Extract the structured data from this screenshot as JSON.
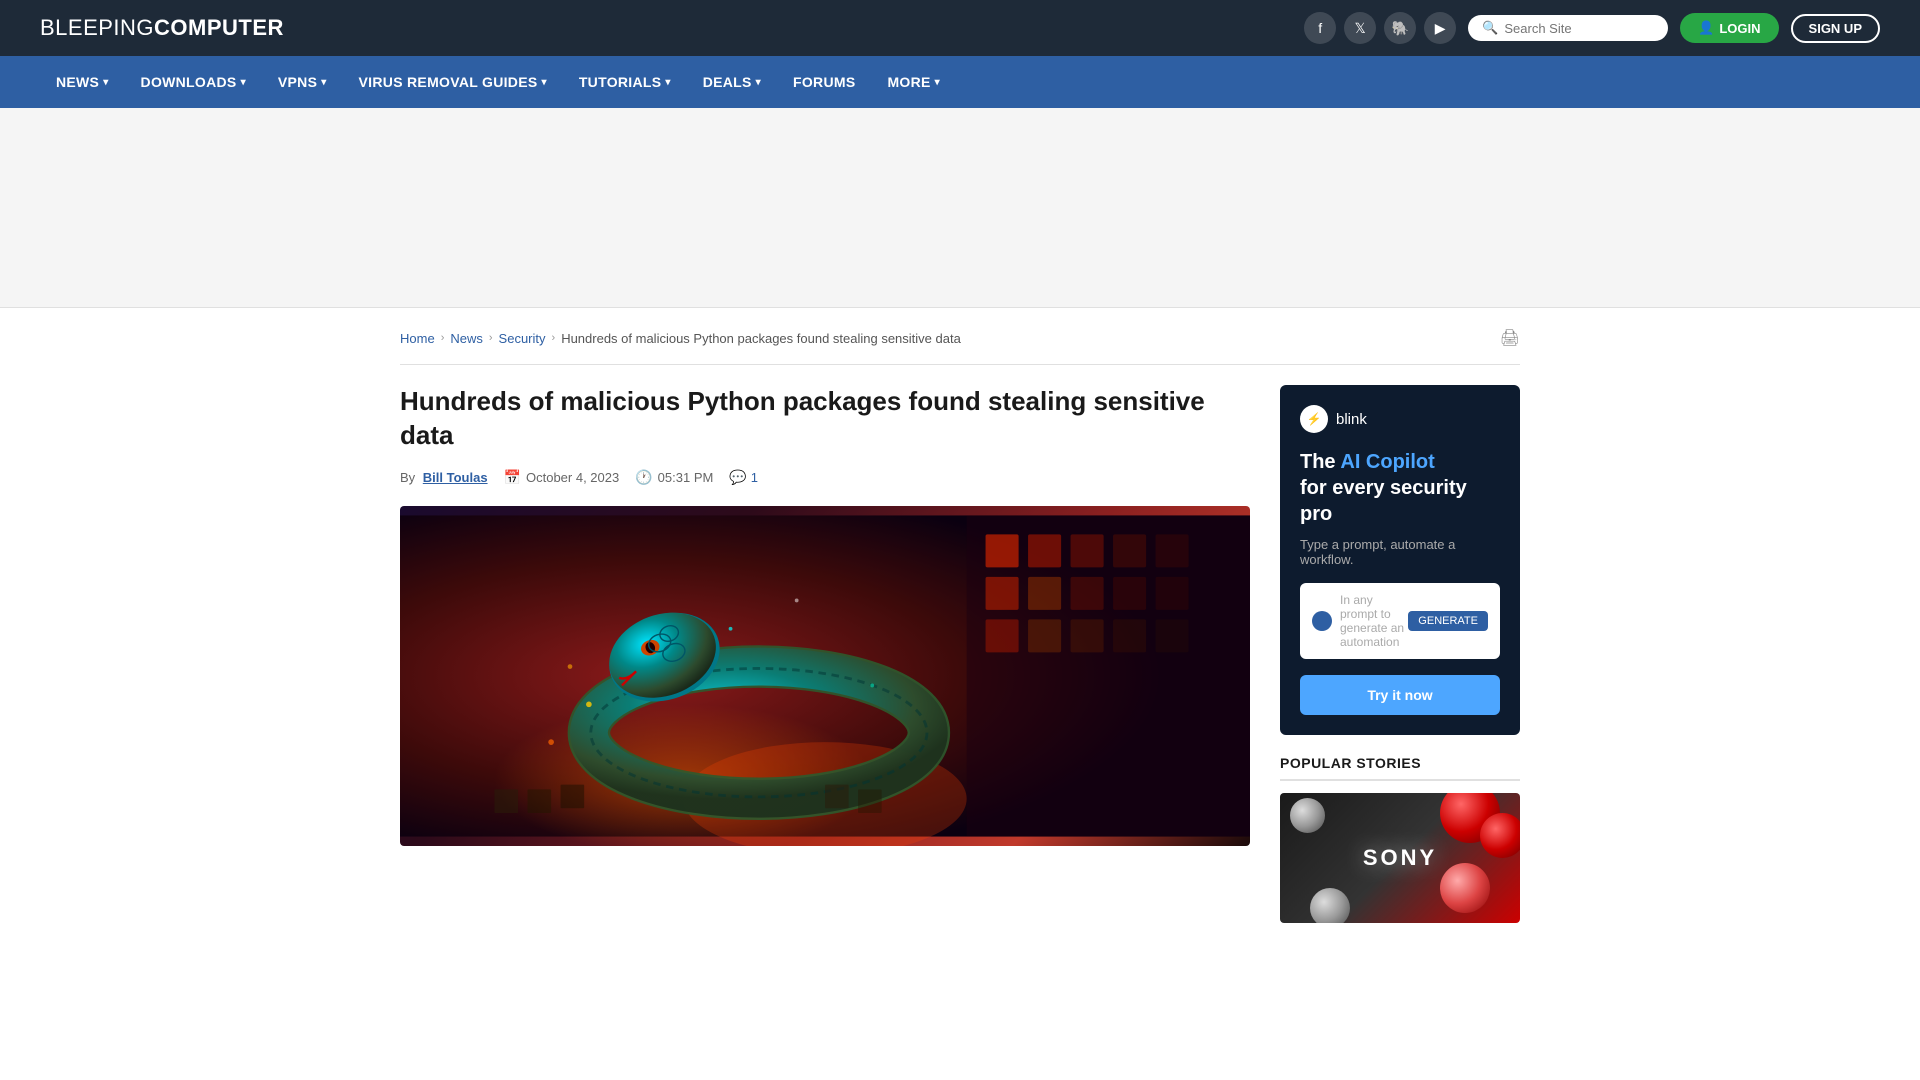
{
  "header": {
    "logo_prefix": "BLEEPING",
    "logo_suffix": "COMPUTER",
    "search_placeholder": "Search Site",
    "login_label": "LOGIN",
    "signup_label": "SIGN UP"
  },
  "social": {
    "facebook": "f",
    "twitter": "t",
    "mastodon": "m",
    "youtube": "▶"
  },
  "nav": {
    "items": [
      {
        "label": "NEWS",
        "has_dropdown": true
      },
      {
        "label": "DOWNLOADS",
        "has_dropdown": true
      },
      {
        "label": "VPNS",
        "has_dropdown": true
      },
      {
        "label": "VIRUS REMOVAL GUIDES",
        "has_dropdown": true
      },
      {
        "label": "TUTORIALS",
        "has_dropdown": true
      },
      {
        "label": "DEALS",
        "has_dropdown": true
      },
      {
        "label": "FORUMS",
        "has_dropdown": false
      },
      {
        "label": "MORE",
        "has_dropdown": true
      }
    ]
  },
  "breadcrumb": {
    "home": "Home",
    "news": "News",
    "security": "Security",
    "current": "Hundreds of malicious Python packages found stealing sensitive data"
  },
  "article": {
    "title": "Hundreds of malicious Python packages found stealing sensitive data",
    "author_label": "By",
    "author_name": "Bill Toulas",
    "date": "October 4, 2023",
    "time": "05:31 PM",
    "comments_count": "1"
  },
  "sidebar_ad": {
    "brand": "blink",
    "headline_plain": "The ",
    "headline_highlight": "AI Copilot",
    "headline_rest": " for every security pro",
    "description": "Type a prompt, automate a workflow.",
    "input_placeholder": "In any prompt to generate an automation",
    "generate_btn": "GENERATE",
    "cta_label": "Try it now"
  },
  "popular_stories": {
    "header": "POPULAR STORIES",
    "items": [
      {
        "brand": "SONY"
      }
    ]
  },
  "colors": {
    "nav_bg": "#2e5fa3",
    "header_bg": "#1e2a38",
    "link_color": "#2e5fa3",
    "login_green": "#28a745",
    "cta_blue": "#4da6ff"
  }
}
